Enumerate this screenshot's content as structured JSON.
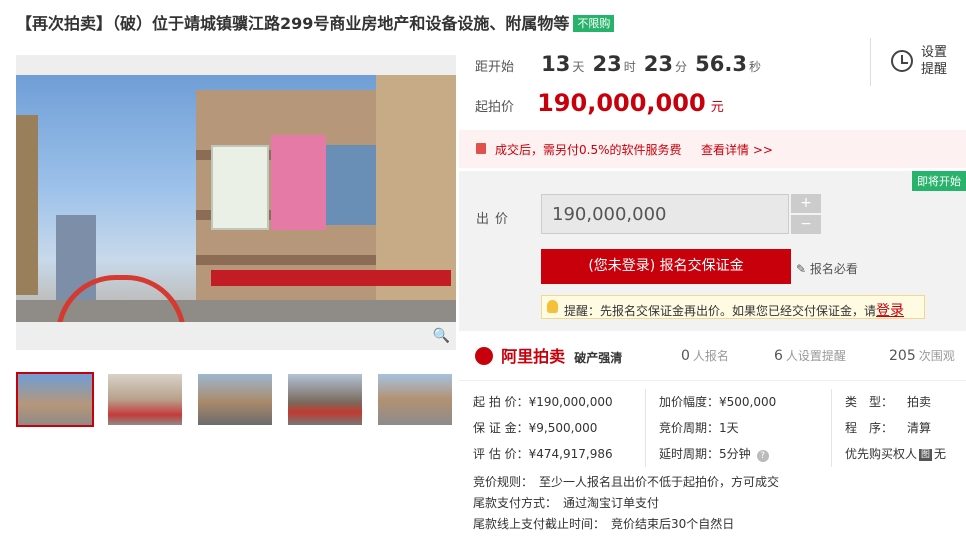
{
  "title": {
    "text": "【再次拍卖】（破）位于靖城镇骥江路299号商业房地产和设备设施、附属物等",
    "badge": "不限购"
  },
  "countdown": {
    "label": "距开始",
    "days": "13",
    "days_unit": "天",
    "hours": "23",
    "hours_unit": "时",
    "minutes": "23",
    "minutes_unit": "分",
    "seconds": "56.3",
    "seconds_unit": "秒"
  },
  "reminder": {
    "line1": "设置",
    "line2": "提醒",
    "icon": "alarm-clock-icon"
  },
  "start_price": {
    "label": "起拍价",
    "value": "190,000,000",
    "unit": "元"
  },
  "fee_notice": {
    "text": "成交后，需另付0.5%的软件服务费",
    "link": "查看详情 >>"
  },
  "bid": {
    "badge": "即将开始",
    "label": "出价",
    "value": "190,000,000",
    "plus": "+",
    "minus": "−",
    "enroll_button": "(您未登录) 报名交保证金",
    "must_read": "报名必看",
    "tip": "提醒：先报名交保证金再出价。如果您已经交付保证金，请",
    "tip_login": "登录"
  },
  "brand": {
    "name": "阿里拍卖",
    "sub": "破产强清"
  },
  "stats": [
    {
      "num": "0",
      "label": "人报名"
    },
    {
      "num": "6",
      "label": "人设置提醒"
    },
    {
      "num": "205",
      "label": "次围观"
    }
  ],
  "info": {
    "col1": [
      {
        "k": "起 拍 价：",
        "v": "¥190,000,000"
      },
      {
        "k": "保 证 金：",
        "v": "¥9,500,000"
      },
      {
        "k": "评 估 价：",
        "v": "¥474,917,986"
      }
    ],
    "col2": [
      {
        "k": "加价幅度：",
        "v": "¥500,000"
      },
      {
        "k": "竞价周期：",
        "v": "1天"
      },
      {
        "k": "延时周期：",
        "v": "5分钟"
      }
    ],
    "col3": [
      {
        "k": "类　型：",
        "v": "拍卖"
      },
      {
        "k": "程　序：",
        "v": "清算"
      },
      {
        "k": "优先购买权人",
        "v": "无"
      }
    ],
    "priority_icon": "图"
  },
  "rules": [
    {
      "k": "竞价规则：",
      "v": "至少一人报名且出价不低于起拍价，方可成交"
    },
    {
      "k": "尾款支付方式：",
      "v": "通过淘宝订单支付"
    },
    {
      "k": "尾款线上支付截止时间：",
      "v": "竞价结束后30个自然日"
    }
  ],
  "colors": {
    "accent": "#c7000b",
    "green": "#27b36b"
  }
}
